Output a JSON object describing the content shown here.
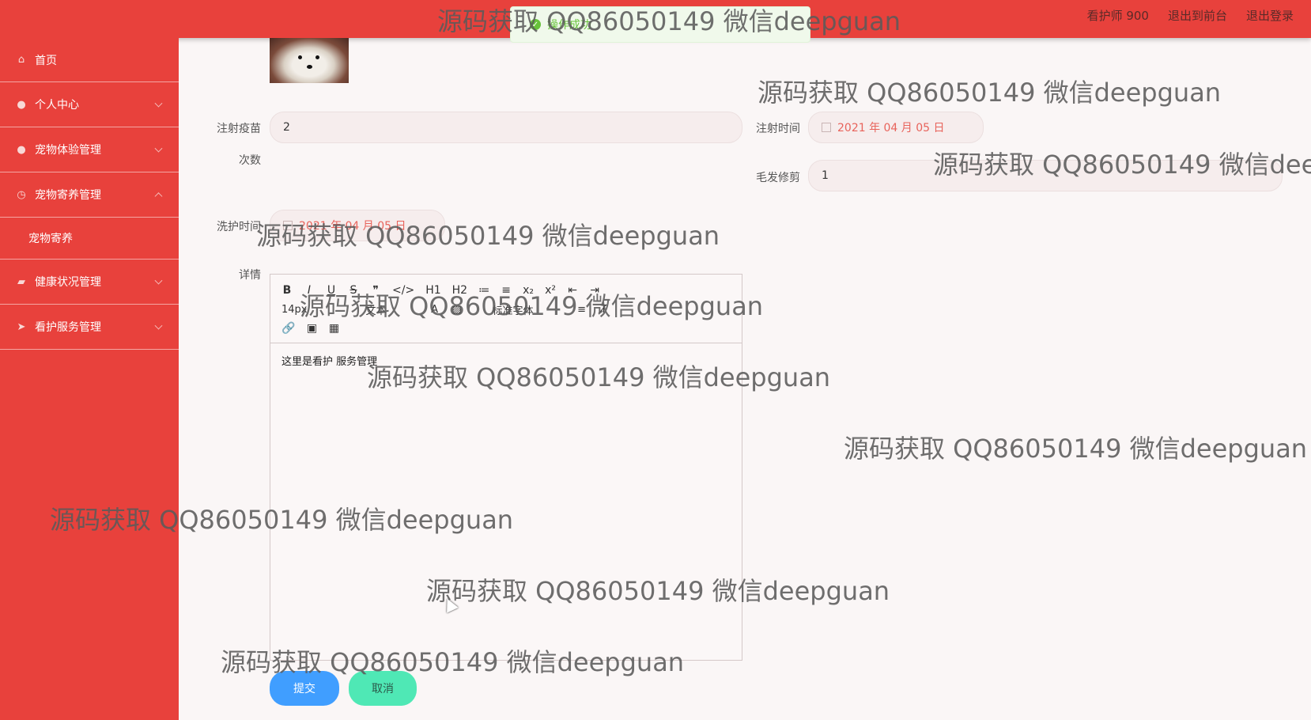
{
  "topbar": {
    "user": "看护师 900",
    "back_to_front": "退出到前台",
    "logout": "退出登录"
  },
  "toast": {
    "message": "操作成功"
  },
  "sidebar": {
    "items": [
      {
        "label": "首页",
        "icon": "home-icon"
      },
      {
        "label": "个人中心",
        "icon": "user-icon"
      },
      {
        "label": "宠物体验管理",
        "icon": "user-icon"
      },
      {
        "label": "宠物寄养管理",
        "icon": "clock-icon"
      },
      {
        "label": "宠物寄养",
        "icon": ""
      },
      {
        "label": "健康状况管理",
        "icon": "briefcase-icon"
      },
      {
        "label": "看护服务管理",
        "icon": "send-icon"
      }
    ]
  },
  "form": {
    "vaccine_label": "注射疫苗",
    "vaccine_label2": "次数",
    "vaccine_value": "2",
    "injection_time_label": "注射时间",
    "injection_time_value": "2021 年 04 月 05 日",
    "grooming_label": "毛发修剪",
    "grooming_value": "1",
    "wash_time_label": "洗护时间",
    "wash_time_value": "2021 年 04 月 05 日",
    "details_label": "详情",
    "details_content": "这里是看护 服务管理",
    "submit": "提交",
    "cancel": "取消"
  },
  "editor_toolbar": {
    "row1": [
      "B",
      "I",
      "U",
      "S",
      "❞",
      "</>",
      "H1",
      "H2",
      "≔",
      "≡",
      "x₂",
      "x²",
      "⇤",
      "⇥"
    ],
    "row2": [
      "14px",
      "文本",
      "A",
      "▨",
      "标准字体",
      "≡",
      "T̸"
    ],
    "row3": [
      "🔗",
      "▣",
      "▦"
    ]
  },
  "watermark": "源码获取 QQ86050149 微信deepguan"
}
